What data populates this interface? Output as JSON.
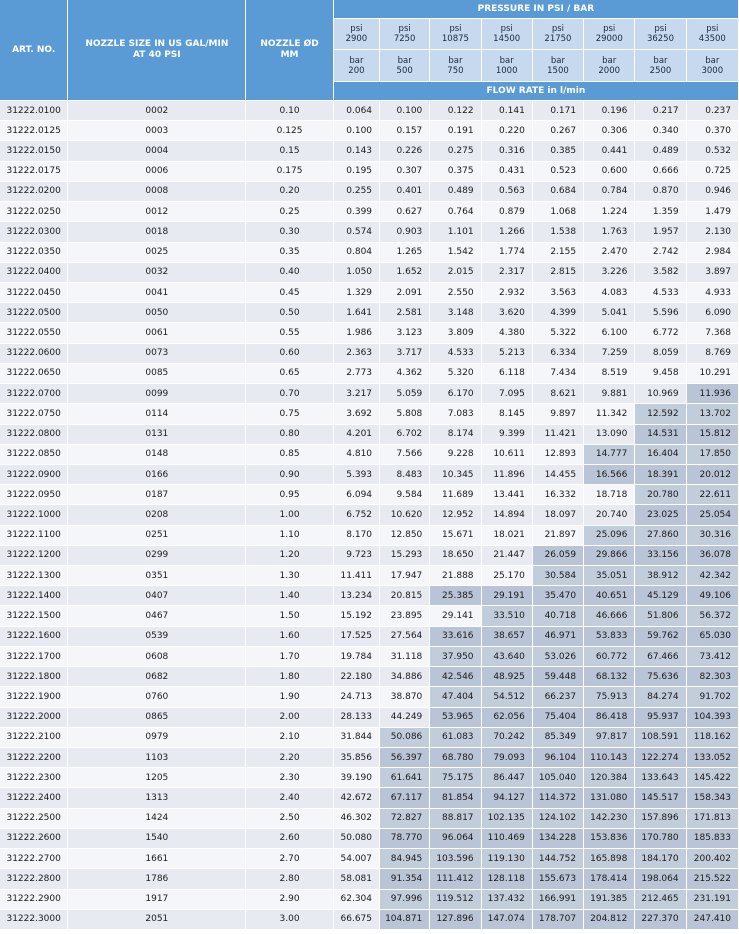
{
  "header": {
    "art_no": "ART. NO.",
    "nozzle_size": "NOZZLE SIZE IN US GAL/MIN AT 40 PSI",
    "nozzle_diameter": "NOZZLE ØD MM",
    "pressure_title": "PRESSURE IN PSI / BAR",
    "flow_rate_title": "FLOW RATE in l/min",
    "psi_values": [
      "psi 2900",
      "psi 7250",
      "psi 10875",
      "psi 14500",
      "psi 21750",
      "psi 29000",
      "psi 36250",
      "psi 43500"
    ],
    "bar_values": [
      "bar 200",
      "bar 500",
      "bar 750",
      "bar 1000",
      "bar 1500",
      "bar 2000",
      "bar 2500",
      "bar 3000"
    ]
  },
  "colors": {
    "header_blue": "#5b9bd5",
    "subheader_blue": "#c6d9ee",
    "row_light": "#e7ebf1",
    "row_lighter": "#f4f6f9",
    "highlight": "#b9c5d6"
  },
  "rows": [
    {
      "art": "31222.0100",
      "size": "0002",
      "d": "0.10",
      "flow": [
        "0.064",
        "0.100",
        "0.122",
        "0.141",
        "0.171",
        "0.196",
        "0.217",
        "0.237"
      ],
      "hl": 0
    },
    {
      "art": "31222.0125",
      "size": "0003",
      "d": "0.125",
      "flow": [
        "0.100",
        "0.157",
        "0.191",
        "0.220",
        "0.267",
        "0.306",
        "0.340",
        "0.370"
      ],
      "hl": 0
    },
    {
      "art": "31222.0150",
      "size": "0004",
      "d": "0.15",
      "flow": [
        "0.143",
        "0.226",
        "0.275",
        "0.316",
        "0.385",
        "0.441",
        "0.489",
        "0.532"
      ],
      "hl": 0
    },
    {
      "art": "31222.0175",
      "size": "0006",
      "d": "0.175",
      "flow": [
        "0.195",
        "0.307",
        "0.375",
        "0.431",
        "0.523",
        "0.600",
        "0.666",
        "0.725"
      ],
      "hl": 0
    },
    {
      "art": "31222.0200",
      "size": "0008",
      "d": "0.20",
      "flow": [
        "0.255",
        "0.401",
        "0.489",
        "0.563",
        "0.684",
        "0.784",
        "0.870",
        "0.946"
      ],
      "hl": 0
    },
    {
      "art": "31222.0250",
      "size": "0012",
      "d": "0.25",
      "flow": [
        "0.399",
        "0.627",
        "0.764",
        "0.879",
        "1.068",
        "1.224",
        "1.359",
        "1.479"
      ],
      "hl": 0
    },
    {
      "art": "31222.0300",
      "size": "0018",
      "d": "0.30",
      "flow": [
        "0.574",
        "0.903",
        "1.101",
        "1.266",
        "1.538",
        "1.763",
        "1.957",
        "2.130"
      ],
      "hl": 0
    },
    {
      "art": "31222.0350",
      "size": "0025",
      "d": "0.35",
      "flow": [
        "0.804",
        "1.265",
        "1.542",
        "1.774",
        "2.155",
        "2.470",
        "2.742",
        "2.984"
      ],
      "hl": 0
    },
    {
      "art": "31222.0400",
      "size": "0032",
      "d": "0.40",
      "flow": [
        "1.050",
        "1.652",
        "2.015",
        "2.317",
        "2.815",
        "3.226",
        "3.582",
        "3.897"
      ],
      "hl": 0
    },
    {
      "art": "31222.0450",
      "size": "0041",
      "d": "0.45",
      "flow": [
        "1.329",
        "2.091",
        "2.550",
        "2.932",
        "3.563",
        "4.083",
        "4.533",
        "4.933"
      ],
      "hl": 0
    },
    {
      "art": "31222.0500",
      "size": "0050",
      "d": "0.50",
      "flow": [
        "1.641",
        "2.581",
        "3.148",
        "3.620",
        "4.399",
        "5.041",
        "5.596",
        "6.090"
      ],
      "hl": 0
    },
    {
      "art": "31222.0550",
      "size": "0061",
      "d": "0.55",
      "flow": [
        "1.986",
        "3.123",
        "3.809",
        "4.380",
        "5.322",
        "6.100",
        "6.772",
        "7.368"
      ],
      "hl": 0
    },
    {
      "art": "31222.0600",
      "size": "0073",
      "d": "0.60",
      "flow": [
        "2.363",
        "3.717",
        "4.533",
        "5.213",
        "6.334",
        "7.259",
        "8.059",
        "8.769"
      ],
      "hl": 0
    },
    {
      "art": "31222.0650",
      "size": "0085",
      "d": "0.65",
      "flow": [
        "2.773",
        "4.362",
        "5.320",
        "6.118",
        "7.434",
        "8.519",
        "9.458",
        "10.291"
      ],
      "hl": 0
    },
    {
      "art": "31222.0700",
      "size": "0099",
      "d": "0.70",
      "flow": [
        "3.217",
        "5.059",
        "6.170",
        "7.095",
        "8.621",
        "9.881",
        "10.969",
        "11.936"
      ],
      "hl": 1
    },
    {
      "art": "31222.0750",
      "size": "0114",
      "d": "0.75",
      "flow": [
        "3.692",
        "5.808",
        "7.083",
        "8.145",
        "9.897",
        "11.342",
        "12.592",
        "13.702"
      ],
      "hl": 2
    },
    {
      "art": "31222.0800",
      "size": "0131",
      "d": "0.80",
      "flow": [
        "4.201",
        "6.702",
        "8.174",
        "9.399",
        "11.421",
        "13.090",
        "14.531",
        "15.812"
      ],
      "hl": 2
    },
    {
      "art": "31222.0850",
      "size": "0148",
      "d": "0.85",
      "flow": [
        "4.810",
        "7.566",
        "9.228",
        "10.611",
        "12.893",
        "14.777",
        "16.404",
        "17.850"
      ],
      "hl": 3
    },
    {
      "art": "31222.0900",
      "size": "0166",
      "d": "0.90",
      "flow": [
        "5.393",
        "8.483",
        "10.345",
        "11.896",
        "14.455",
        "16.566",
        "18.391",
        "20.012"
      ],
      "hl": 3
    },
    {
      "art": "31222.0950",
      "size": "0187",
      "d": "0.95",
      "flow": [
        "6.094",
        "9.584",
        "11.689",
        "13.441",
        "16.332",
        "18.718",
        "20.780",
        "22.611"
      ],
      "hl": 2
    },
    {
      "art": "31222.1000",
      "size": "0208",
      "d": "1.00",
      "flow": [
        "6.752",
        "10.620",
        "12.952",
        "14.894",
        "18.097",
        "20.740",
        "23.025",
        "25.054"
      ],
      "hl": 2
    },
    {
      "art": "31222.1100",
      "size": "0251",
      "d": "1.10",
      "flow": [
        "8.170",
        "12.850",
        "15.671",
        "18.021",
        "21.897",
        "25.096",
        "27.860",
        "30.316"
      ],
      "hl": 3
    },
    {
      "art": "31222.1200",
      "size": "0299",
      "d": "1.20",
      "flow": [
        "9.723",
        "15.293",
        "18.650",
        "21.447",
        "26.059",
        "29.866",
        "33.156",
        "36.078"
      ],
      "hl": 4
    },
    {
      "art": "31222.1300",
      "size": "0351",
      "d": "1.30",
      "flow": [
        "11.411",
        "17.947",
        "21.888",
        "25.170",
        "30.584",
        "35.051",
        "38.912",
        "42.342"
      ],
      "hl": 4
    },
    {
      "art": "31222.1400",
      "size": "0407",
      "d": "1.40",
      "flow": [
        "13.234",
        "20.815",
        "25.385",
        "29.191",
        "35.470",
        "40.651",
        "45.129",
        "49.106"
      ],
      "hl": 6
    },
    {
      "art": "31222.1500",
      "size": "0467",
      "d": "1.50",
      "flow": [
        "15.192",
        "23.895",
        "29.141",
        "33.510",
        "40.718",
        "46.666",
        "51.806",
        "56.372"
      ],
      "hl": 5
    },
    {
      "art": "31222.1600",
      "size": "0539",
      "d": "1.60",
      "flow": [
        "17.525",
        "27.564",
        "33.616",
        "38.657",
        "46.971",
        "53.833",
        "59.762",
        "65.030"
      ],
      "hl": 6
    },
    {
      "art": "31222.1700",
      "size": "0608",
      "d": "1.70",
      "flow": [
        "19.784",
        "31.118",
        "37.950",
        "43.640",
        "53.026",
        "60.772",
        "67.466",
        "73.412"
      ],
      "hl": 6
    },
    {
      "art": "31222.1800",
      "size": "0682",
      "d": "1.80",
      "flow": [
        "22.180",
        "34.886",
        "42.546",
        "48.925",
        "59.448",
        "68.132",
        "75.636",
        "82.303"
      ],
      "hl": 6
    },
    {
      "art": "31222.1900",
      "size": "0760",
      "d": "1.90",
      "flow": [
        "24.713",
        "38.870",
        "47.404",
        "54.512",
        "66.237",
        "75.913",
        "84.274",
        "91.702"
      ],
      "hl": 6
    },
    {
      "art": "31222.2000",
      "size": "0865",
      "d": "2.00",
      "flow": [
        "28.133",
        "44.249",
        "53.965",
        "62.056",
        "75.404",
        "86.418",
        "95.937",
        "104.393"
      ],
      "hl": 6
    },
    {
      "art": "31222.2100",
      "size": "0979",
      "d": "2.10",
      "flow": [
        "31.844",
        "50.086",
        "61.083",
        "70.242",
        "85.349",
        "97.817",
        "108.591",
        "118.162"
      ],
      "hl": 7
    },
    {
      "art": "31222.2200",
      "size": "1103",
      "d": "2.20",
      "flow": [
        "35.856",
        "56.397",
        "68.780",
        "79.093",
        "96.104",
        "110.143",
        "122.274",
        "133.052"
      ],
      "hl": 7
    },
    {
      "art": "31222.2300",
      "size": "1205",
      "d": "2.30",
      "flow": [
        "39.190",
        "61.641",
        "75.175",
        "86.447",
        "105.040",
        "120.384",
        "133.643",
        "145.422"
      ],
      "hl": 7
    },
    {
      "art": "31222.2400",
      "size": "1313",
      "d": "2.40",
      "flow": [
        "42.672",
        "67.117",
        "81.854",
        "94.127",
        "114.372",
        "131.080",
        "145.517",
        "158.343"
      ],
      "hl": 7
    },
    {
      "art": "31222.2500",
      "size": "1424",
      "d": "2.50",
      "flow": [
        "46.302",
        "72.827",
        "88.817",
        "102.135",
        "124.102",
        "142.230",
        "157.896",
        "171.813"
      ],
      "hl": 7
    },
    {
      "art": "31222.2600",
      "size": "1540",
      "d": "2.60",
      "flow": [
        "50.080",
        "78.770",
        "96.064",
        "110.469",
        "134.228",
        "153.836",
        "170.780",
        "185.833"
      ],
      "hl": 7
    },
    {
      "art": "31222.2700",
      "size": "1661",
      "d": "2.70",
      "flow": [
        "54.007",
        "84.945",
        "103.596",
        "119.130",
        "144.752",
        "165.898",
        "184.170",
        "200.402"
      ],
      "hl": 7
    },
    {
      "art": "31222.2800",
      "size": "1786",
      "d": "2.80",
      "flow": [
        "58.081",
        "91.354",
        "111.412",
        "128.118",
        "155.673",
        "178.414",
        "198.064",
        "215.522"
      ],
      "hl": 7
    },
    {
      "art": "31222.2900",
      "size": "1917",
      "d": "2.90",
      "flow": [
        "62.304",
        "97.996",
        "119.512",
        "137.432",
        "166.991",
        "191.385",
        "212.465",
        "231.191"
      ],
      "hl": 7
    },
    {
      "art": "31222.3000",
      "size": "2051",
      "d": "3.00",
      "flow": [
        "66.675",
        "104.871",
        "127.896",
        "147.074",
        "178.707",
        "204.812",
        "227.370",
        "247.410"
      ],
      "hl": 7
    }
  ]
}
